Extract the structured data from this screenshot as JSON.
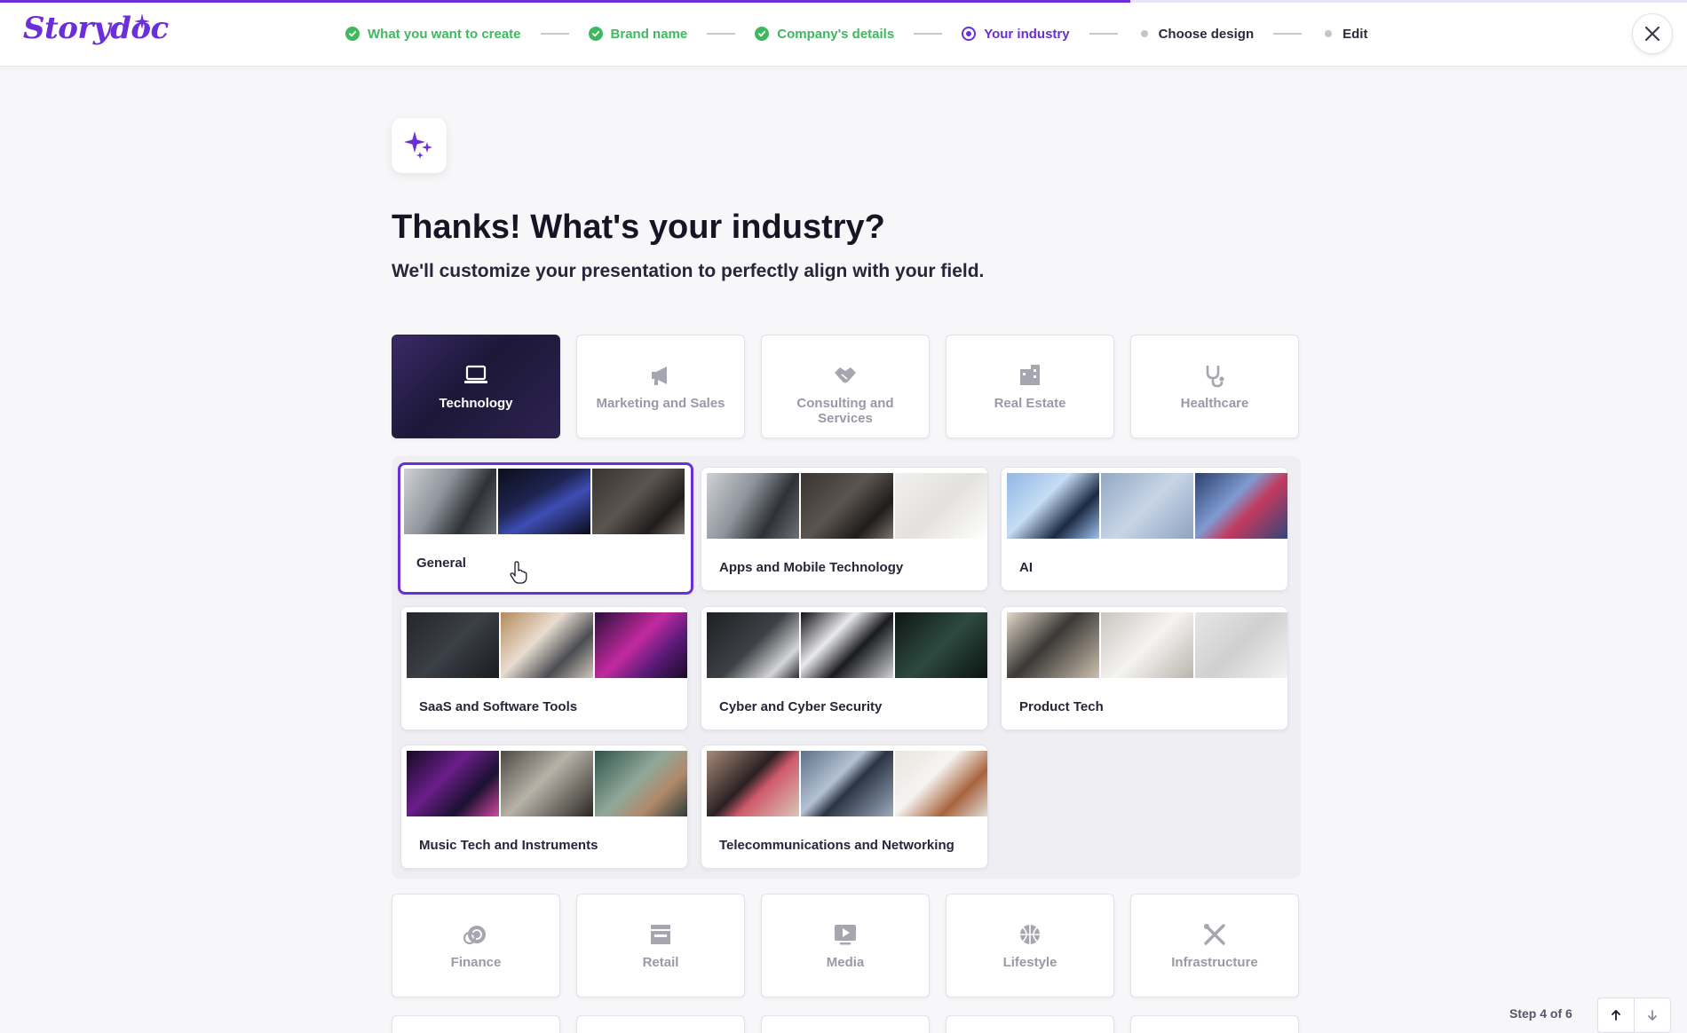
{
  "brand": {
    "logo_text": "Storydoc",
    "accent": "#6a2fd6",
    "done_color": "#3fb85f"
  },
  "progress": {
    "fraction": 0.67
  },
  "steps": [
    {
      "label": "What you want to create",
      "state": "done"
    },
    {
      "label": "Brand name",
      "state": "done"
    },
    {
      "label": "Company's details",
      "state": "done"
    },
    {
      "label": "Your industry",
      "state": "current"
    },
    {
      "label": "Choose design",
      "state": "todo"
    },
    {
      "label": "Edit",
      "state": "todo"
    }
  ],
  "main": {
    "title": "Thanks! What's your industry?",
    "subtitle": "We'll customize your presentation to perfectly align with your field."
  },
  "industries_top": [
    {
      "label": "Technology",
      "icon": "laptop-icon",
      "selected": true
    },
    {
      "label": "Marketing and Sales",
      "icon": "megaphone-icon",
      "selected": false
    },
    {
      "label": "Consulting and Services",
      "icon": "handshake-icon",
      "selected": false
    },
    {
      "label": "Real Estate",
      "icon": "building-icon",
      "selected": false
    },
    {
      "label": "Healthcare",
      "icon": "stethoscope-icon",
      "selected": false
    }
  ],
  "subcategories": [
    {
      "label": "General",
      "selected": true
    },
    {
      "label": "Apps and Mobile Technology",
      "selected": false
    },
    {
      "label": "AI",
      "selected": false
    },
    {
      "label": "SaaS and Software Tools",
      "selected": false
    },
    {
      "label": "Cyber and Cyber Security",
      "selected": false
    },
    {
      "label": "Product Tech",
      "selected": false
    },
    {
      "label": "Music Tech and Instruments",
      "selected": false
    },
    {
      "label": "Telecommunications and Networking",
      "selected": false
    }
  ],
  "industries_bottom": [
    {
      "label": "Finance",
      "icon": "coins-icon"
    },
    {
      "label": "Retail",
      "icon": "storefront-icon"
    },
    {
      "label": "Media",
      "icon": "play-screen-icon"
    },
    {
      "label": "Lifestyle",
      "icon": "ball-icon"
    },
    {
      "label": "Infrastructure",
      "icon": "tools-icon"
    }
  ],
  "footer": {
    "step_text": "Step 4 of 6"
  }
}
